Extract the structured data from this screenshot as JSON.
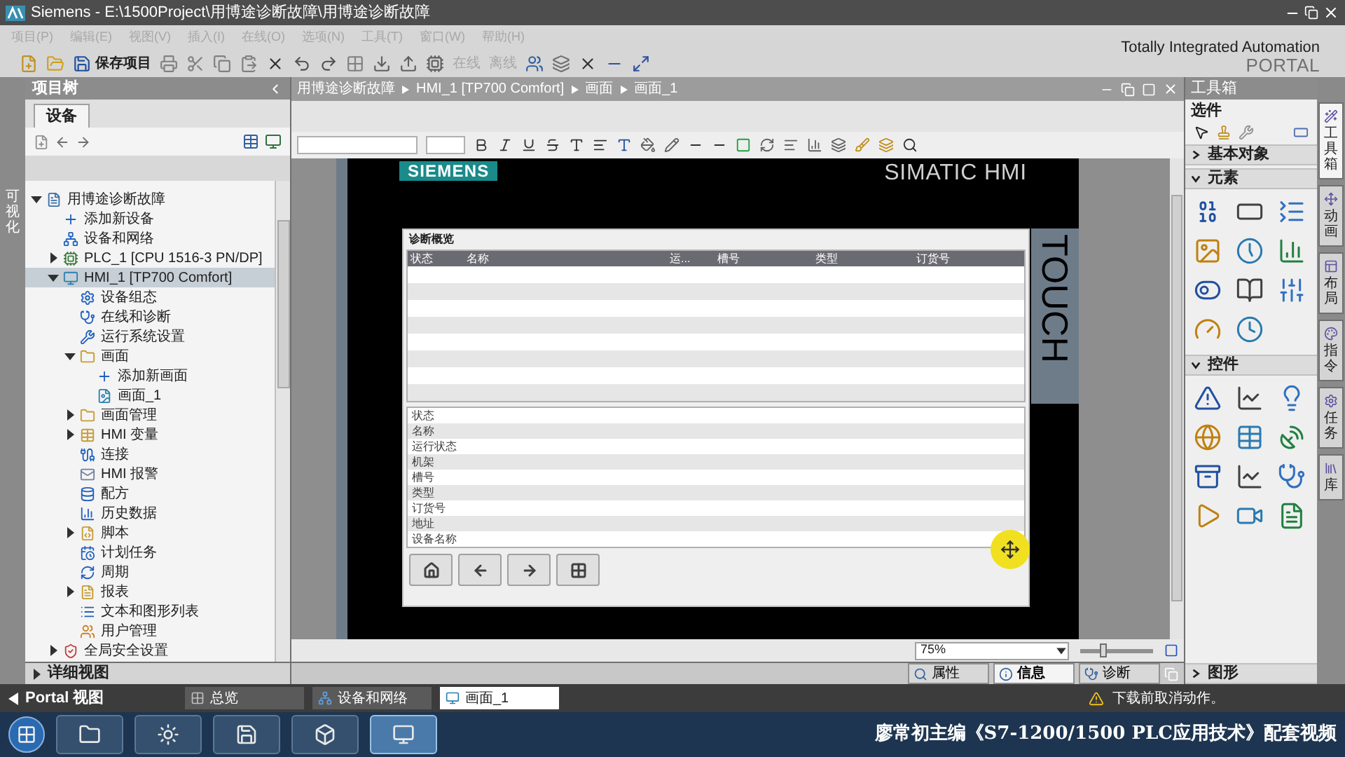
{
  "window": {
    "title": "Siemens  -  E:\\1500Project\\用博途诊断故障\\用博途诊断故障"
  },
  "menu": [
    {
      "label": "项目(P)",
      "disabled": true
    },
    {
      "label": "编辑(E)",
      "disabled": true
    },
    {
      "label": "视图(V)",
      "disabled": true
    },
    {
      "label": "插入(I)",
      "disabled": true
    },
    {
      "label": "在线(O)",
      "disabled": true
    },
    {
      "label": "选项(N)",
      "disabled": true
    },
    {
      "label": "工具(T)",
      "disabled": true
    },
    {
      "label": "窗口(W)",
      "disabled": true
    },
    {
      "label": "帮助(H)",
      "disabled": true
    }
  ],
  "toolbar": {
    "save_label": "保存项目",
    "online": {
      "label": "在线",
      "disabled": true
    },
    "offline": {
      "label": "离线",
      "disabled": true
    }
  },
  "brand": {
    "line_1": "Totally Integrated Automation",
    "line_2": "PORTAL"
  },
  "side_strip": {
    "label": "可视化"
  },
  "project_tree": {
    "title": "项目树",
    "tab": "设备",
    "detail_view": "详细视图",
    "items": [
      {
        "label": "用博途诊断故障",
        "kind": "project",
        "expanded": true,
        "selected": false,
        "children": [
          {
            "label": "添加新设备",
            "kind": "add",
            "selected": false
          },
          {
            "label": "设备和网络",
            "kind": "network",
            "selected": false
          },
          {
            "label": "PLC_1 [CPU 1516-3 PN/DP]",
            "kind": "plc",
            "expanded": false,
            "selected": false
          },
          {
            "label": "HMI_1 [TP700 Comfort]",
            "kind": "hmi",
            "expanded": true,
            "selected": true,
            "children": [
              {
                "label": "设备组态",
                "kind": "config",
                "selected": false
              },
              {
                "label": "在线和诊断",
                "kind": "online",
                "selected": false
              },
              {
                "label": "运行系统设置",
                "kind": "runtime",
                "selected": false
              },
              {
                "label": "画面",
                "kind": "folder",
                "expanded": true,
                "selected": false,
                "children": [
                  {
                    "label": "添加新画面",
                    "kind": "add",
                    "selected": false
                  },
                  {
                    "label": "画面_1",
                    "kind": "screen",
                    "selected": false
                  }
                ]
              },
              {
                "label": "画面管理",
                "kind": "folder",
                "expanded": false,
                "selected": false
              },
              {
                "label": "HMI 变量",
                "kind": "tags",
                "expanded": false,
                "selected": false
              },
              {
                "label": "连接",
                "kind": "connection",
                "selected": false
              },
              {
                "label": "HMI 报警",
                "kind": "alarm",
                "selected": false
              },
              {
                "label": "配方",
                "kind": "recipe",
                "selected": false
              },
              {
                "label": "历史数据",
                "kind": "archive",
                "selected": false
              },
              {
                "label": "脚本",
                "kind": "script",
                "expanded": false,
                "selected": false
              },
              {
                "label": "计划任务",
                "kind": "task",
                "selected": false
              },
              {
                "label": "周期",
                "kind": "cycle",
                "selected": false
              },
              {
                "label": "报表",
                "kind": "report",
                "expanded": false,
                "selected": false
              },
              {
                "label": "文本和图形列表",
                "kind": "textlist",
                "selected": false
              },
              {
                "label": "用户管理",
                "kind": "user",
                "selected": false
              }
            ]
          },
          {
            "label": "全局安全设置",
            "kind": "security",
            "expanded": false,
            "selected": false
          }
        ]
      }
    ]
  },
  "editor": {
    "breadcrumb": [
      "用博途诊断故障",
      "HMI_1 [TP700 Comfort]",
      "画面",
      "画面_1"
    ],
    "device": {
      "logo": "SIEMENS",
      "model": "SIMATIC HMI",
      "side_label": "TOUCH"
    },
    "diagnostics_view": {
      "title": "诊断概览",
      "columns": [
        "状态",
        "名称",
        "运...",
        "槽号",
        "类型",
        "订货号"
      ],
      "detail_labels": [
        "状态",
        "名称",
        "运行状态",
        "机架",
        "槽号",
        "类型",
        "订货号",
        "地址",
        "设备名称"
      ]
    },
    "zoom": {
      "value": "75%",
      "level": 0.3
    },
    "bottom_tabs": [
      {
        "label": "属性",
        "selected": false
      },
      {
        "label": "信息",
        "selected": true
      },
      {
        "label": "诊断",
        "selected": false
      }
    ]
  },
  "toolbox": {
    "title": "工具箱",
    "options_label": "选件",
    "sections": [
      {
        "title": "基本对象",
        "kind": "basic",
        "expanded": false
      },
      {
        "title": "元素",
        "kind": "elements",
        "expanded": true
      },
      {
        "title": "控件",
        "kind": "controls",
        "expanded": true
      },
      {
        "title": "图形",
        "kind": "graphics",
        "expanded": false
      }
    ]
  },
  "side_tabs": [
    {
      "label": "工具箱",
      "selected": true
    },
    {
      "label": "动画",
      "selected": false
    },
    {
      "label": "布局",
      "selected": false
    },
    {
      "label": "指令",
      "selected": false
    },
    {
      "label": "任务",
      "selected": false
    },
    {
      "label": "库",
      "selected": false
    }
  ],
  "portal_bar": {
    "portal_label": "Portal 视图",
    "tabs": [
      {
        "label": "总览",
        "selected": false
      },
      {
        "label": "设备和网络",
        "selected": false
      },
      {
        "label": "画面_1",
        "selected": true
      }
    ],
    "status": "下载前取消动作。"
  },
  "taskbar": {
    "caption": "廖常初主编《S7-1200/1500 PLC应用技术》配套视频"
  }
}
